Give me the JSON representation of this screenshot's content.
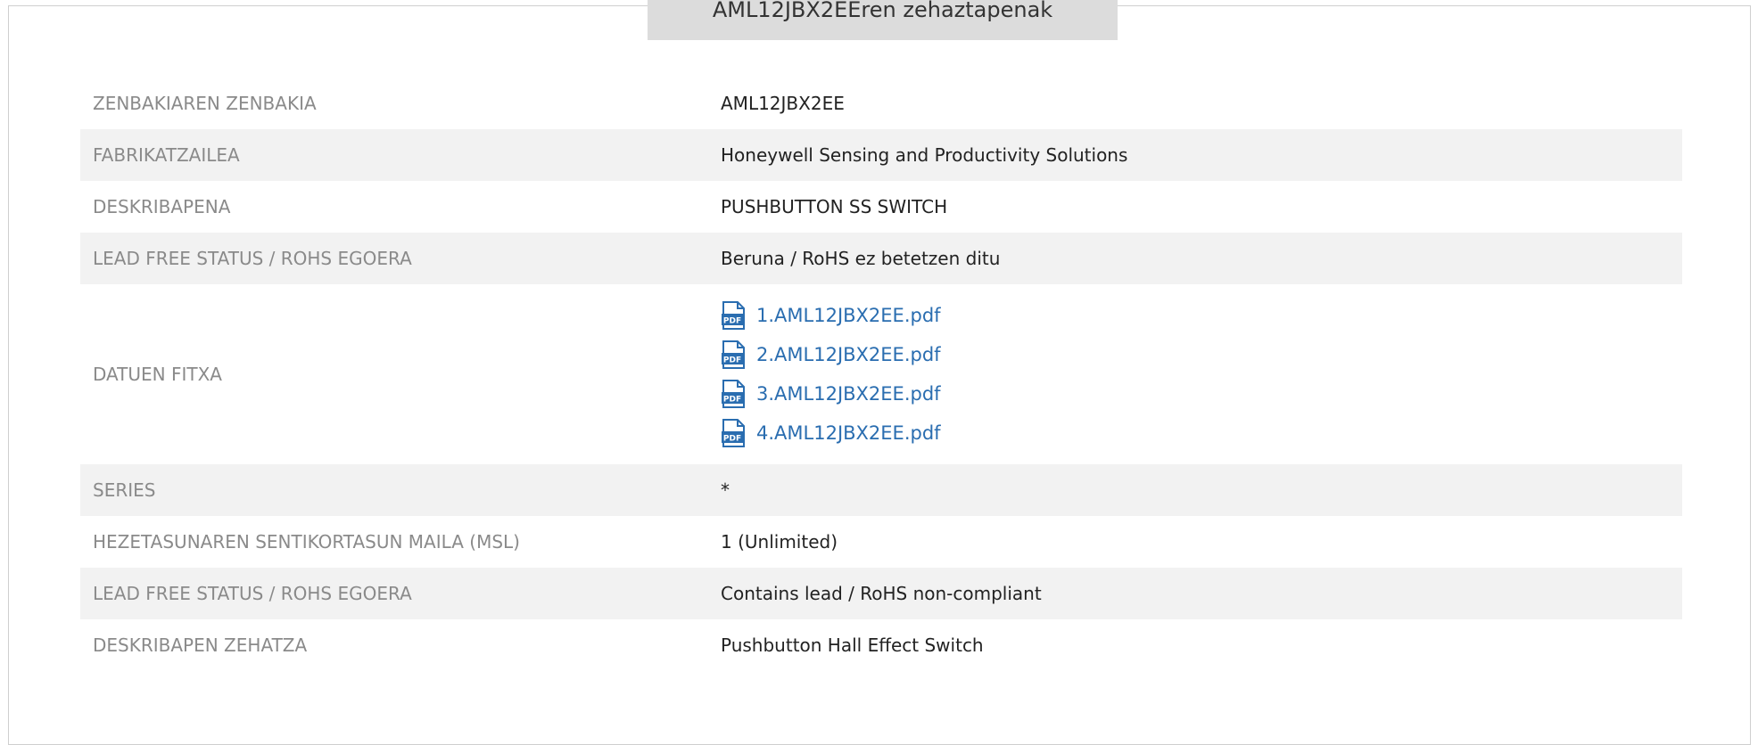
{
  "page": {
    "title": "AML12JBX2EEren zehaztapenak"
  },
  "specs": [
    {
      "label": "ZENBAKIAREN ZENBAKIA",
      "value": "AML12JBX2EE"
    },
    {
      "label": "FABRIKATZAILEA",
      "value": "Honeywell Sensing and Productivity Solutions"
    },
    {
      "label": "DESKRIBAPENA",
      "value": "PUSHBUTTON SS SWITCH"
    },
    {
      "label": "LEAD FREE STATUS / ROHS EGOERA",
      "value": "Beruna / RoHS ez betetzen ditu"
    },
    {
      "label": "DATUEN FITXA",
      "files": [
        "1.AML12JBX2EE.pdf",
        "2.AML12JBX2EE.pdf",
        "3.AML12JBX2EE.pdf",
        "4.AML12JBX2EE.pdf"
      ]
    },
    {
      "label": "SERIES",
      "value": "*"
    },
    {
      "label": "HEZETASUNAREN SENTIKORTASUN MAILA (MSL)",
      "value": "1 (Unlimited)"
    },
    {
      "label": "LEAD FREE STATUS / ROHS EGOERA",
      "value": "Contains lead / RoHS non-compliant"
    },
    {
      "label": "DESKRIBAPEN ZEHATZA",
      "value": "Pushbutton Hall Effect Switch"
    }
  ],
  "icons": {
    "pdf": "pdf-file-icon"
  },
  "colors": {
    "link": "#2a6db0",
    "label": "#8a8a8a",
    "row_alt": "#f2f2f2",
    "title_bg": "#dcdcdc"
  }
}
